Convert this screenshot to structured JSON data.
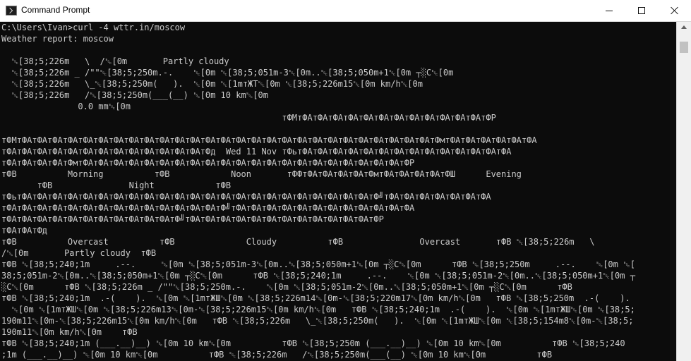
{
  "window": {
    "title": "Command Prompt"
  },
  "console": {
    "lines": [
      "C:\\Users\\Ivan>curl -4 wttr.in/moscow",
      "Weather report: moscow",
      "",
      "  ␛[38;5;226m   \\  /␛[0m       Partly cloudy",
      "  ␛[38;5;226m _ /\"\"␛[38;5;250m.-.    ␛[0m ␛[38;5;051m-3␛[0m..␛[38;5;050m+1␛[0m ┬░C␛[0m",
      "  ␛[38;5;226m   \\_␛[38;5;250m(   ).  ␛[0m ␛[1mтЖТ␛[0m ␛[38;5;226m15␛[0m km/h␛[0m",
      "  ␛[38;5;226m   /␛[38;5;250m(___(__) ␛[0m 10 km␛[0m",
      "               0.0 mm␛[0m",
      "                                                       тФМтФАтФАтФАтФАтФАтФАтФАтФАтФАтФАтФАтФАтФР",
      "",
      "тФМтФАтФАтФАтФАтФАтФАтФАтФАтФАтФАтФАтФАтФАтФАтФАтФАтФАтФАтФАтФАтФАтФАтФАтФАтФАтФАтФАтФмтФАтФАтФАтФАтФАтФА",
      "тФАтФАтФАтФАтФАтФАтФАтФАтФАтФАтФАтФАтФАтФд  Wed 11 Nov тФьтФАтФАтФАтФАтФАтФАтФАтФАтФАтФАтФАтФАтФАтФА",
      "тФАтФАтФАтФАтФмтФАтФАтФАтФАтФАтФАтФАтФАтФАтФАтФАтФАтФАтФАтФАтФАтФАтФАтФАтФАтФАтФР",
      "тФВ          Morning          тФВ            Noon       тФФтФАтФАтФАтФАтФмтФАтФАтФАтФАтФШ      Evening",
      "       тФВ               Night            тФВ",
      "тФьтФАтФАтФАтФАтФАтФАтФАтФАтФАтФАтФАтФАтФАтФАтФАтФАтФАтФАтФАтФАтФАтФАтФАтФ╝тФАтФАтФАтФАтФАтФАтФА",
      "тФАтФАтФАтФАтФАтФАтФАтФАтФАтФАтФАтФАтФАтФАтФ╝тФАтФАтФАтФАтФАтФАтФАтФАтФАтФАтФАтФА",
      "тФАтФАтФАтФАтФАтФАтФАтФАтФАтФАтФАтФ╝тФАтФАтФАтФАтФАтФАтФАтФАтФАтФАтФАтФАтФР",
      "тФАтФАтФд",
      "тФВ          Overcast          тФВ              Cloudy          тФВ               Overcast       тФВ ␛[38;5;226m   \\",
      "/␛[0m       Partly cloudy  тФВ",
      "тФВ ␛[38;5;240;1m     .--.     ␛[0m ␛[38;5;051m-3␛[0m..␛[38;5;050m+1␛[0m ┬░C␛[0m      тФВ ␛[38;5;250m     .--.    ␛[0m ␛[",
      "38;5;051m-2␛[0m..␛[38;5;050m+1␛[0m ┬░C␛[0m      тФВ ␛[38;5;240;1m     .--.    ␛[0m ␛[38;5;051m-2␛[0m..␛[38;5;050m+1␛[0m ┬",
      "░C␛[0m      тФВ ␛[38;5;226m _ /\"\"␛[38;5;250m.-.    ␛[0m ␛[38;5;051m-2␛[0m..␛[38;5;050m+1␛[0m ┬░C␛[0m      тФВ",
      "тФВ ␛[38;5;240;1m  .-(    ).  ␛[0m ␛[1mтЖШ␛[0m ␛[38;5;226m14␛[0m-␛[38;5;220m17␛[0m km/h␛[0m   тФВ ␛[38;5;250m  .-(    ).",
      "  ␛[0m ␛[1mтЖШ␛[0m ␛[38;5;226m13␛[0m-␛[38;5;226m15␛[0m km/h␛[0m   тФВ ␛[38;5;240;1m  .-(    ).  ␛[0m ␛[1mтЖШ␛[0m ␛[38;5;",
      "190m11␛[0m-␛[38;5;226m15␛[0m km/h␛[0m   тФВ ␛[38;5;226m   \\_␛[38;5;250m(   ).  ␛[0m ␛[1mтЖШ␛[0m ␛[38;5;154m8␛[0m-␛[38;5;",
      "190m11␛[0m km/h␛[0m    тФВ",
      "тФВ ␛[38;5;240;1m (___.__)__) ␛[0m 10 km␛[0m          тФВ ␛[38;5;250m (___.__)__) ␛[0m 10 km␛[0m          тФВ ␛[38;5;240",
      ";1m (___.__)__) ␛[0m 10 km␛[0m          тФВ ␛[38;5;226m   /␛[38;5;250m(___(__) ␛[0m 10 km␛[0m          тФВ"
    ]
  }
}
